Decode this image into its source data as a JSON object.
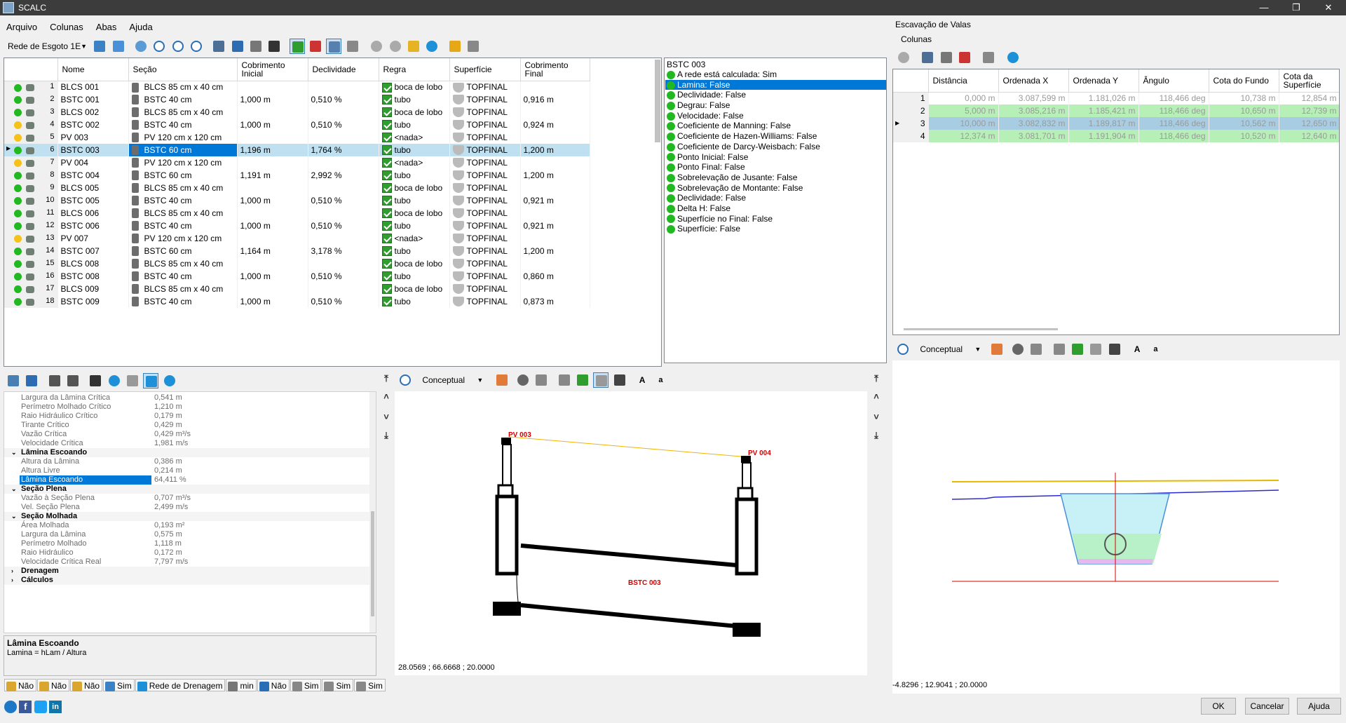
{
  "window": {
    "title": "SCALC",
    "min": "—",
    "max": "❐",
    "close": "✕"
  },
  "menu": [
    "Arquivo",
    "Colunas",
    "Abas",
    "Ajuda"
  ],
  "toolbar": {
    "network_select": "Rede de Esgoto 1E"
  },
  "main_grid": {
    "headers": [
      "Nome",
      "Seção",
      "Cobrimento Inicial",
      "Declividade",
      "Regra",
      "Superfície",
      "Cobrimento Final"
    ],
    "rows": [
      {
        "n": "1",
        "status": "green",
        "name": "BLCS 001",
        "section": "BLCS 85 cm x 40 cm",
        "cob_ini": "",
        "decl": "",
        "rule": "boca de lobo",
        "surface": "TOPFINAL",
        "cob_fin": ""
      },
      {
        "n": "2",
        "status": "green",
        "name": "BSTC 001",
        "section": "BSTC 40 cm",
        "cob_ini": "1,000 m",
        "decl": "0,510 %",
        "rule": "tubo",
        "surface": "TOPFINAL",
        "cob_fin": "0,916 m"
      },
      {
        "n": "3",
        "status": "green",
        "name": "BLCS 002",
        "section": "BLCS 85 cm x 40 cm",
        "cob_ini": "",
        "decl": "",
        "rule": "boca de lobo",
        "surface": "TOPFINAL",
        "cob_fin": ""
      },
      {
        "n": "4",
        "status": "yellow",
        "name": "BSTC 002",
        "section": "BSTC 40 cm",
        "cob_ini": "1,000 m",
        "decl": "0,510 %",
        "rule": "tubo",
        "surface": "TOPFINAL",
        "cob_fin": "0,924 m"
      },
      {
        "n": "5",
        "status": "yellow",
        "name": "PV 003",
        "section": "PV 120 cm x 120 cm",
        "cob_ini": "",
        "decl": "",
        "rule": "<nada>",
        "surface": "TOPFINAL",
        "cob_fin": ""
      },
      {
        "n": "6",
        "status": "green",
        "name": "BSTC 003",
        "section": "BSTC 60 cm",
        "cob_ini": "1,196 m",
        "decl": "1,764 %",
        "rule": "tubo",
        "surface": "TOPFINAL",
        "cob_fin": "1,200 m"
      },
      {
        "n": "7",
        "status": "yellow",
        "name": "PV 004",
        "section": "PV 120 cm x 120 cm",
        "cob_ini": "",
        "decl": "",
        "rule": "<nada>",
        "surface": "TOPFINAL",
        "cob_fin": ""
      },
      {
        "n": "8",
        "status": "green",
        "name": "BSTC 004",
        "section": "BSTC 60 cm",
        "cob_ini": "1,191 m",
        "decl": "2,992 %",
        "rule": "tubo",
        "surface": "TOPFINAL",
        "cob_fin": "1,200 m"
      },
      {
        "n": "9",
        "status": "green",
        "name": "BLCS 005",
        "section": "BLCS 85 cm x 40 cm",
        "cob_ini": "",
        "decl": "",
        "rule": "boca de lobo",
        "surface": "TOPFINAL",
        "cob_fin": ""
      },
      {
        "n": "10",
        "status": "green",
        "name": "BSTC 005",
        "section": "BSTC 40 cm",
        "cob_ini": "1,000 m",
        "decl": "0,510 %",
        "rule": "tubo",
        "surface": "TOPFINAL",
        "cob_fin": "0,921 m"
      },
      {
        "n": "11",
        "status": "green",
        "name": "BLCS 006",
        "section": "BLCS 85 cm x 40 cm",
        "cob_ini": "",
        "decl": "",
        "rule": "boca de lobo",
        "surface": "TOPFINAL",
        "cob_fin": ""
      },
      {
        "n": "12",
        "status": "green",
        "name": "BSTC 006",
        "section": "BSTC 40 cm",
        "cob_ini": "1,000 m",
        "decl": "0,510 %",
        "rule": "tubo",
        "surface": "TOPFINAL",
        "cob_fin": "0,921 m"
      },
      {
        "n": "13",
        "status": "yellow",
        "name": "PV 007",
        "section": "PV 120 cm x 120 cm",
        "cob_ini": "",
        "decl": "",
        "rule": "<nada>",
        "surface": "TOPFINAL",
        "cob_fin": ""
      },
      {
        "n": "14",
        "status": "green",
        "name": "BSTC 007",
        "section": "BSTC 60 cm",
        "cob_ini": "1,164 m",
        "decl": "3,178 %",
        "rule": "tubo",
        "surface": "TOPFINAL",
        "cob_fin": "1,200 m"
      },
      {
        "n": "15",
        "status": "green",
        "name": "BLCS 008",
        "section": "BLCS 85 cm x 40 cm",
        "cob_ini": "",
        "decl": "",
        "rule": "boca de lobo",
        "surface": "TOPFINAL",
        "cob_fin": ""
      },
      {
        "n": "16",
        "status": "green",
        "name": "BSTC 008",
        "section": "BSTC 40 cm",
        "cob_ini": "1,000 m",
        "decl": "0,510 %",
        "rule": "tubo",
        "surface": "TOPFINAL",
        "cob_fin": "0,860 m"
      },
      {
        "n": "17",
        "status": "green",
        "name": "BLCS 009",
        "section": "BLCS 85 cm x 40 cm",
        "cob_ini": "",
        "decl": "",
        "rule": "boca de lobo",
        "surface": "TOPFINAL",
        "cob_fin": ""
      },
      {
        "n": "18",
        "status": "green",
        "name": "BSTC 009",
        "section": "BSTC 40 cm",
        "cob_ini": "1,000 m",
        "decl": "0,510 %",
        "rule": "tubo",
        "surface": "TOPFINAL",
        "cob_fin": "0,873 m"
      }
    ]
  },
  "status_panel": {
    "title": "BSTC 003",
    "items": [
      "A rede está calculada: Sim",
      "Lamina: False",
      "Declividade: False",
      "Degrau: False",
      "Velocidade: False",
      "Coeficiente de Manning: False",
      "Coeficiente de Hazen-Williams: False",
      "Coeficiente de Darcy-Weisbach: False",
      "Ponto Inicial: False",
      "Ponto Final: False",
      "Sobrelevação de Jusante: False",
      "Sobrelevação de Montante: False",
      "Declividade: False",
      "Delta H: False",
      "Superfície no Final: False",
      "Superfície: False"
    ]
  },
  "properties": {
    "rows": [
      {
        "kind": "item",
        "name": "Largura da Lâmina Crítica",
        "value": "0,541 m"
      },
      {
        "kind": "item",
        "name": "Perímetro Molhado Crítico",
        "value": "1,210 m"
      },
      {
        "kind": "item",
        "name": "Raio Hidráulico Crítico",
        "value": "0,179 m"
      },
      {
        "kind": "item",
        "name": "Tirante Crítico",
        "value": "0,429 m"
      },
      {
        "kind": "item",
        "name": "Vazão Crítica",
        "value": "0,429 m³/s"
      },
      {
        "kind": "item",
        "name": "Velocidade Crítica",
        "value": "1,981 m/s"
      },
      {
        "kind": "cat",
        "name": "Lâmina Escoando",
        "value": "",
        "tw": "⌄"
      },
      {
        "kind": "item",
        "name": "Altura da Lâmina",
        "value": "0,386 m"
      },
      {
        "kind": "item",
        "name": "Altura Livre",
        "value": "0,214 m"
      },
      {
        "kind": "sel",
        "name": "Lâmina Escoando",
        "value": "64,411 %"
      },
      {
        "kind": "cat",
        "name": "Seção Plena",
        "value": "",
        "tw": "⌄"
      },
      {
        "kind": "item",
        "name": "Vazão à Seção Plena",
        "value": "0,707 m³/s"
      },
      {
        "kind": "item",
        "name": "Vel. Seção Plena",
        "value": "2,499 m/s"
      },
      {
        "kind": "cat",
        "name": "Seção Molhada",
        "value": "",
        "tw": "⌄"
      },
      {
        "kind": "item",
        "name": "Área Molhada",
        "value": "0,193 m²"
      },
      {
        "kind": "item",
        "name": "Largura da Lâmina",
        "value": "0,575 m"
      },
      {
        "kind": "item",
        "name": "Perímetro Molhado",
        "value": "1,118 m"
      },
      {
        "kind": "item",
        "name": "Raio Hidráulico",
        "value": "0,172 m"
      },
      {
        "kind": "item",
        "name": "Velocidade Crítica Real",
        "value": "7,797 m/s"
      },
      {
        "kind": "cat",
        "name": "Drenagem",
        "value": "",
        "tw": "›"
      },
      {
        "kind": "cat",
        "name": "Cálculos",
        "value": "",
        "tw": "›"
      }
    ],
    "desc_title": "Lâmina Escoando",
    "desc_text": "Lamina = hLam / Altura"
  },
  "profile_view": {
    "style": "Conceptual",
    "font_big": "A",
    "font_small": "a",
    "label_start": "PV 003",
    "label_end": "PV 004",
    "label_pipe": "BSTC 003",
    "coords": "28.0569 ; 66.6668 ; 20.0000"
  },
  "excavation": {
    "title": "Escavação de Valas",
    "columns_menu": "Colunas",
    "headers": [
      "Distância",
      "Ordenada X",
      "Ordenada Y",
      "Ângulo",
      "Cota do Fundo",
      "Cota da Superfície"
    ],
    "rows": [
      {
        "n": "1",
        "cells": [
          "0,000 m",
          "3.087,599 m",
          "1.181,026 m",
          "118,466 deg",
          "10,738 m",
          "12,854 m"
        ],
        "style": "plain"
      },
      {
        "n": "2",
        "cells": [
          "5,000 m",
          "3.085,216 m",
          "1.185,421 m",
          "118,466 deg",
          "10,650 m",
          "12,739 m"
        ],
        "style": "green"
      },
      {
        "n": "3",
        "cells": [
          "10,000 m",
          "3.082,832 m",
          "1.189,817 m",
          "118,466 deg",
          "10,562 m",
          "12,650 m"
        ],
        "style": "blue"
      },
      {
        "n": "4",
        "cells": [
          "12,374 m",
          "3.081,701 m",
          "1.191,904 m",
          "118,466 deg",
          "10,520 m",
          "12,640 m"
        ],
        "style": "green"
      }
    ],
    "view_style": "Conceptual",
    "coords": "-4.8296 ; 12.9041 ; 20.0000"
  },
  "bottom_chips": [
    {
      "label": "Não"
    },
    {
      "label": "Não"
    },
    {
      "label": "Não"
    },
    {
      "label": "Sim"
    },
    {
      "label": "Rede de Drenagem"
    },
    {
      "label": "min"
    },
    {
      "label": "Não"
    },
    {
      "label": "Sim"
    },
    {
      "label": "Sim"
    },
    {
      "label": "Sim"
    }
  ],
  "buttons": {
    "ok": "OK",
    "cancel": "Cancelar",
    "help": "Ajuda"
  },
  "colors": {
    "accent": "#0078d7",
    "row_selected": "#bfe0f0",
    "ok_green": "#22b822",
    "warn_yellow": "#f4c21a"
  }
}
